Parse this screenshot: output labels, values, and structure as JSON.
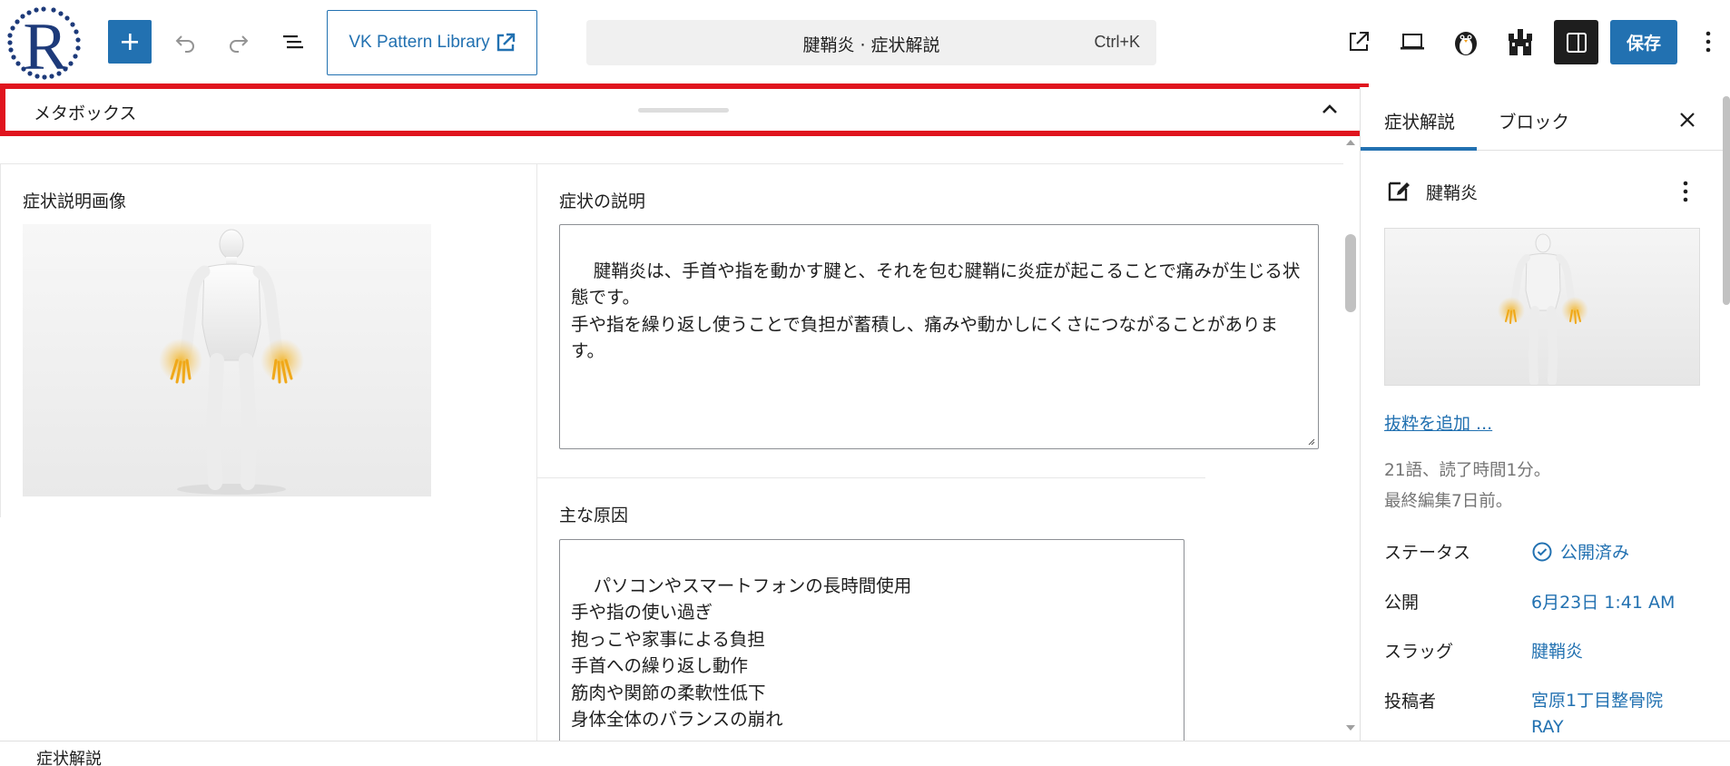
{
  "toolbar": {
    "logo_letter": "R",
    "add_icon": "plus-icon",
    "undo_icon": "undo-icon",
    "redo_icon": "redo-icon",
    "list_view_icon": "list-view-icon",
    "pattern_library_label": "VK Pattern Library",
    "command_title": "腱鞘炎 · 症状解説",
    "command_shortcut": "Ctrl+K",
    "view_post_icon": "external-link-icon",
    "preview_icon": "laptop-icon",
    "save_label": "保存",
    "options_icon": "more-vertical-icon"
  },
  "metabox": {
    "title": "メタボックス",
    "image_label": "症状説明画像",
    "description_label": "症状の説明",
    "description_value": "腱鞘炎は、手首や指を動かす腱と、それを包む腱鞘に炎症が起こることで痛みが生じる状態です。\n手や指を繰り返し使うことで負担が蓄積し、痛みや動かしにくさにつながることがあります。",
    "causes_label": "主な原因",
    "causes_value": "パソコンやスマートフォンの長時間使用\n手や指の使い過ぎ\n抱っこや家事による負担\n手首への繰り返し動作\n筋肉や関節の柔軟性低下\n身体全体のバランスの崩れ"
  },
  "sidebar": {
    "tabs": [
      {
        "label": "症状解説",
        "active": true
      },
      {
        "label": "ブロック",
        "active": false
      }
    ],
    "post_title": "腱鞘炎",
    "excerpt_link": "抜粋を追加 ...",
    "word_count": "21語、読了時間1分。",
    "last_edited": "最終編集7日前。",
    "rows": [
      {
        "label": "ステータス",
        "value": "公開済み"
      },
      {
        "label": "公開",
        "value": "6月23日 1:41 AM"
      },
      {
        "label": "スラッグ",
        "value": "腱鞘炎"
      },
      {
        "label": "投稿者",
        "value": "宮原1丁目整骨院 RAY"
      }
    ]
  },
  "footer": {
    "breadcrumb": "症状解説"
  },
  "colors": {
    "accent": "#2271b1",
    "highlight_border": "#e0141e",
    "dark": "#1e1e1e"
  }
}
